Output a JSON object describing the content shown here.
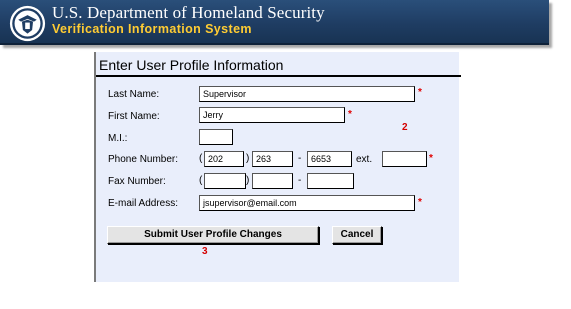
{
  "header": {
    "department": "U.S. Department of Homeland Security",
    "system_name": "Verification Information System",
    "seal_icon": "dhs-seal-icon",
    "colors": {
      "banner": "#1f3d63",
      "system_text": "#ffcc33"
    }
  },
  "form": {
    "title": "Enter User Profile Information",
    "required_marker": "*",
    "fields": {
      "last_name": {
        "label": "Last Name:",
        "value": "Supervisor"
      },
      "first_name": {
        "label": "First Name:",
        "value": "Jerry"
      },
      "middle_initial": {
        "label": "M.I.:",
        "value": ""
      },
      "phone": {
        "label": "Phone Number:",
        "open_paren": "(",
        "close_paren": ")",
        "dash": "-",
        "area": "202",
        "prefix": "263",
        "line": "6653",
        "ext_label": "ext.",
        "ext": ""
      },
      "fax": {
        "label": "Fax Number:",
        "open_paren": "(",
        "close_paren": ")",
        "dash": "-",
        "area": "",
        "prefix": "",
        "line": ""
      },
      "email": {
        "label": "E-mail Address:",
        "value": "jsupervisor@email.com"
      }
    },
    "buttons": {
      "submit": "Submit User Profile Changes",
      "cancel": "Cancel"
    },
    "callouts": {
      "step2": "2",
      "step3": "3"
    }
  }
}
